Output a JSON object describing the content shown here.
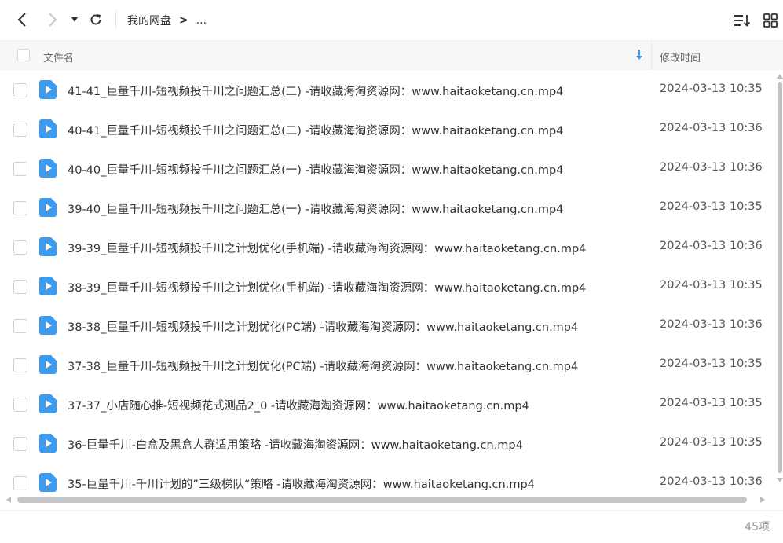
{
  "toolbar": {
    "breadcrumb_root": "我的网盘",
    "breadcrumb_sep": ">",
    "breadcrumb_more": "..."
  },
  "header": {
    "name_col": "文件名",
    "time_col": "修改时间"
  },
  "files": [
    {
      "name": "41-41_巨量千川-短视频投千川之问题汇总(二) -请收藏海淘资源网：www.haitaoketang.cn.mp4",
      "time": "2024-03-13 10:35"
    },
    {
      "name": "40-41_巨量千川-短视频投千川之问题汇总(二) -请收藏海淘资源网：www.haitaoketang.cn.mp4",
      "time": "2024-03-13 10:36"
    },
    {
      "name": "40-40_巨量千川-短视频投千川之问题汇总(一) -请收藏海淘资源网：www.haitaoketang.cn.mp4",
      "time": "2024-03-13 10:36"
    },
    {
      "name": "39-40_巨量千川-短视频投千川之问题汇总(一) -请收藏海淘资源网：www.haitaoketang.cn.mp4",
      "time": "2024-03-13 10:35"
    },
    {
      "name": "39-39_巨量千川-短视频投千川之计划优化(手机端) -请收藏海淘资源网：www.haitaoketang.cn.mp4",
      "time": "2024-03-13 10:36"
    },
    {
      "name": "38-39_巨量千川-短视频投千川之计划优化(手机端) -请收藏海淘资源网：www.haitaoketang.cn.mp4",
      "time": "2024-03-13 10:35"
    },
    {
      "name": "38-38_巨量千川-短视频投千川之计划优化(PC端) -请收藏海淘资源网：www.haitaoketang.cn.mp4",
      "time": "2024-03-13 10:36"
    },
    {
      "name": "37-38_巨量千川-短视频投千川之计划优化(PC端) -请收藏海淘资源网：www.haitaoketang.cn.mp4",
      "time": "2024-03-13 10:35"
    },
    {
      "name": "37-37_小店随心推-短视频花式测品2_0 -请收藏海淘资源网：www.haitaoketang.cn.mp4",
      "time": "2024-03-13 10:35"
    },
    {
      "name": "36-巨量千川-白盒及黑盒人群适用策略 -请收藏海淘资源网：www.haitaoketang.cn.mp4",
      "time": "2024-03-13 10:35"
    },
    {
      "name": "35-巨量千川-千川计划的”三级梯队“策略 -请收藏海淘资源网：www.haitaoketang.cn.mp4",
      "time": "2024-03-13 10:36"
    }
  ],
  "footer": {
    "count": "45项"
  },
  "colors": {
    "file_icon": "#3d9bf0",
    "header_bg": "#f7f7f7"
  }
}
